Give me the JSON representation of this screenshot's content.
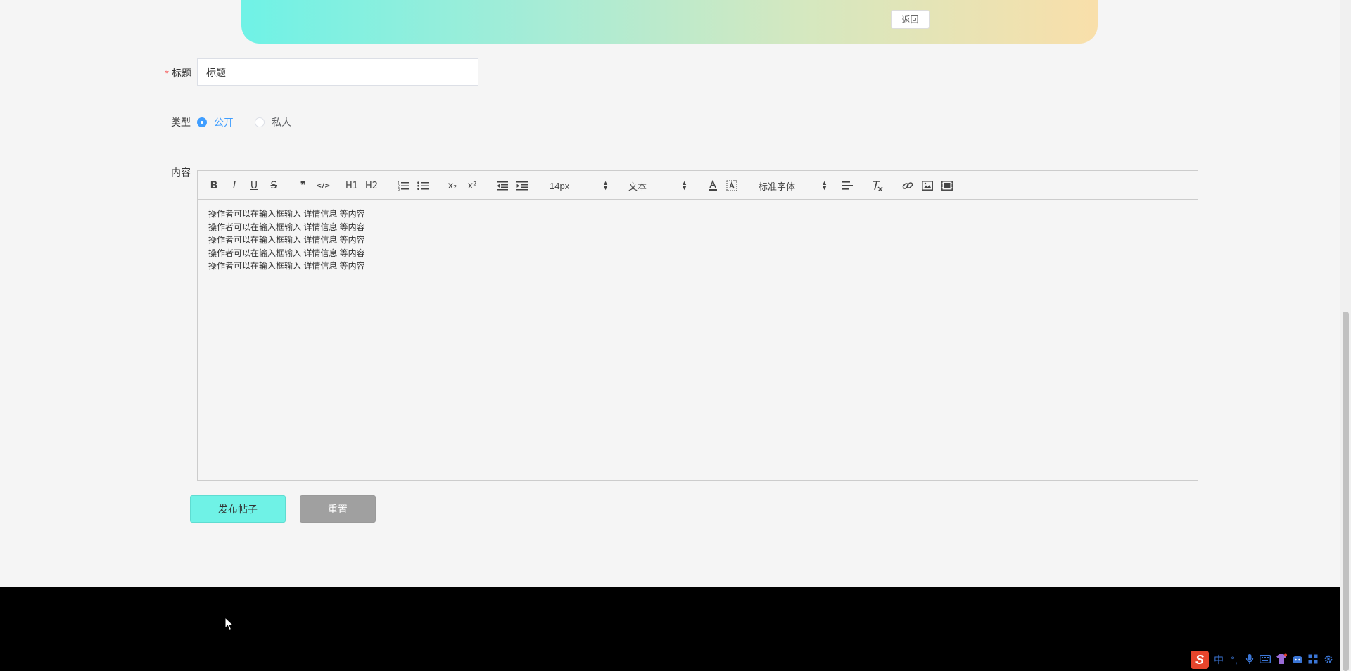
{
  "banner": {
    "back_label": "返回"
  },
  "form": {
    "title": {
      "label": "标题",
      "required_mark": "*",
      "value": "标题"
    },
    "type": {
      "label": "类型",
      "options": [
        {
          "label": "公开",
          "checked": true
        },
        {
          "label": "私人",
          "checked": false
        }
      ]
    },
    "content": {
      "label": "内容",
      "toolbar": {
        "bold": "B",
        "italic": "I",
        "underline": "U",
        "strike": "S",
        "blockquote": "❞",
        "code": "</>",
        "h1": "H1",
        "h2": "H2",
        "subscript": "x₂",
        "superscript": "x²",
        "size_value": "14px",
        "header_value": "文本",
        "font_value": "标准字体"
      },
      "lines": [
        "操作者可以在输入框输入  详情信息  等内容",
        "操作者可以在输入框输入  详情信息  等内容",
        "操作者可以在输入框输入  详情信息  等内容",
        "操作者可以在输入框输入  详情信息  等内容",
        "操作者可以在输入框输入  详情信息  等内容"
      ]
    },
    "buttons": {
      "publish": "发布帖子",
      "reset": "重置"
    }
  },
  "tray": {
    "ime_logo": "S",
    "ime_mode": "中",
    "punct": "°,",
    "colors": {
      "ime_logo_bg": "#e7452c",
      "tray_icon": "#3b76d6"
    }
  },
  "colors": {
    "banner_start": "#6ff2e6",
    "banner_end": "#f9dfaa",
    "publish_bg": "#6ff2e6",
    "reset_bg": "#a0a0a0",
    "accent": "#409eff",
    "required": "#f56c6c",
    "footer_bg": "#000000"
  }
}
